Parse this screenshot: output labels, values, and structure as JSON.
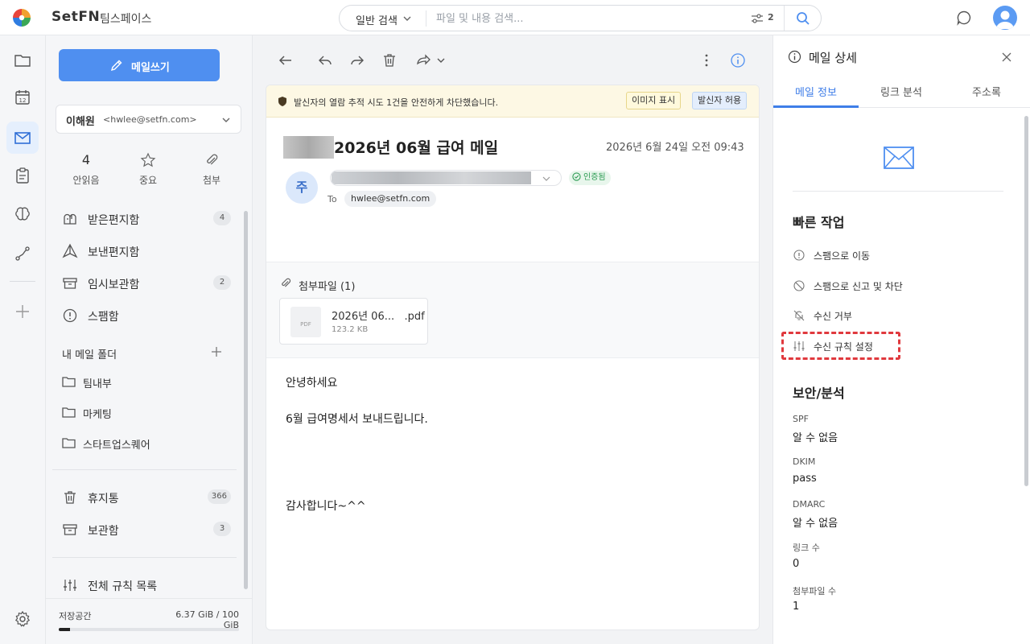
{
  "app": {
    "brand": "SetFN",
    "workspace": "팀스페이스"
  },
  "search": {
    "type_label": "일반 검색",
    "placeholder": "파일 및 내용 검색...",
    "filter_count": "2"
  },
  "sidebar": {
    "compose_label": "메일쓰기",
    "account_name": "이해원",
    "account_email": "<hwlee@setfn.com>",
    "stats": [
      {
        "value": "4",
        "label": "안읽음"
      },
      {
        "label": "중요",
        "icon": "star-icon"
      },
      {
        "label": "첨부",
        "icon": "paperclip-icon"
      }
    ],
    "mailboxes": [
      {
        "label": "받은편지함",
        "badge": "4",
        "icon": "mailbox-icon"
      },
      {
        "label": "보낸편지함",
        "icon": "send-icon"
      },
      {
        "label": "임시보관함",
        "badge": "2",
        "icon": "drafts-icon"
      },
      {
        "label": "스팸함",
        "icon": "spam-icon"
      }
    ],
    "folders_title": "내 메일 폴더",
    "folders": [
      "팀내부",
      "마케팅",
      "스타트업스퀘어"
    ],
    "system": [
      {
        "label": "휴지통",
        "badge": "366",
        "icon": "trash-icon"
      },
      {
        "label": "보관함",
        "badge": "3",
        "icon": "archive-icon"
      }
    ],
    "rules_label": "전체 규칙 목록",
    "storage_label": "저장공간",
    "storage_value": "6.37 GiB / 100 GiB",
    "storage_fraction": 0.0637
  },
  "mail": {
    "banner_text": "발신자의 열람 추적 시도 1건을 안전하게 차단했습니다.",
    "banner_show_images": "이미지 표시",
    "banner_allow_sender": "발신자 허용",
    "subject": "2026년 06월 급여 메일",
    "date": "2026년 6월 24일 오전 09:43",
    "sender_initial": "주",
    "verified": "인증됨",
    "to_label": "To",
    "to_email": "hwlee@setfn.com",
    "attachments_title": "첨부파일 (1)",
    "attachment_name": "2026년 06...   .pdf",
    "attachment_size": "123.2 KB",
    "attachment_type": "PDF",
    "body": [
      "안녕하세요",
      "6월 급여명세서 보내드립니다.",
      "감사합니다~^^"
    ]
  },
  "detail": {
    "title": "메일 상세",
    "tabs": [
      "메일 정보",
      "링크 분석",
      "주소록"
    ],
    "quick_title": "빠른 작업",
    "quick_actions": [
      {
        "label": "스팸으로 이동",
        "icon": "alert-circle-icon"
      },
      {
        "label": "스팸으로 신고 및 차단",
        "icon": "block-icon"
      },
      {
        "label": "수신 거부",
        "icon": "bell-off-icon"
      },
      {
        "label": "수신 규칙 설정",
        "icon": "sliders-icon"
      }
    ],
    "security_title": "보안/분석",
    "security": [
      {
        "key": "SPF",
        "value": "알 수 없음"
      },
      {
        "key": "DKIM",
        "value": "pass"
      },
      {
        "key": "DMARC",
        "value": "알 수 없음"
      },
      {
        "key": "링크 수",
        "value": "0"
      },
      {
        "key": "첨부파일 수",
        "value": "1"
      }
    ]
  },
  "colors": {
    "accent": "#4f8ff0",
    "highlight": "#e0393e",
    "verified": "#2e9c54",
    "banner": "#fdf8e4"
  }
}
